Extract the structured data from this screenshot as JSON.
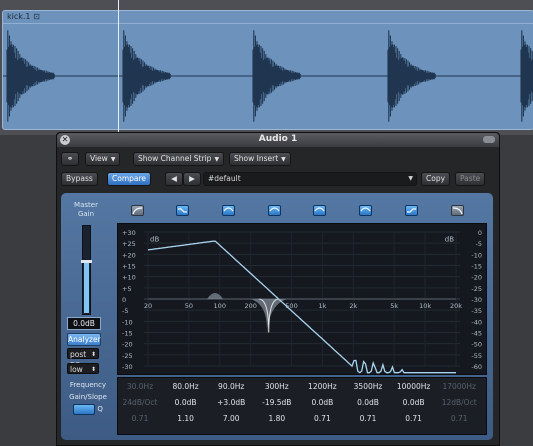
{
  "arrange": {
    "region_name": "kick.1 ⊡"
  },
  "window": {
    "title": "Audio 1",
    "toolbar": {
      "link_icon": "link-icon",
      "view": "View",
      "show_channel_strip": "Show Channel Strip",
      "show_insert": "Show Insert"
    },
    "controls": {
      "bypass": "Bypass",
      "compare": "Compare",
      "prev": "◀",
      "next": "▶",
      "preset": "#default",
      "copy": "Copy",
      "paste": "Paste"
    }
  },
  "eq": {
    "master_gain_label": "Master Gain",
    "master_gain_value": "0.0dB",
    "analyzer": "Analyzer",
    "analyzer_position": "post EQ",
    "resolution": "low",
    "db_unit_left": "dB",
    "db_unit_right": "dB",
    "gain_scale": [
      "+30",
      "+25",
      "+20",
      "+15",
      "+10",
      "+5",
      "0",
      "-5",
      "-10",
      "-15",
      "-20",
      "-25",
      "-30"
    ],
    "analyzer_scale": [
      "0",
      "-5",
      "-10",
      "-15",
      "-20",
      "-25",
      "-30",
      "-35",
      "-40",
      "-45",
      "-50",
      "-55",
      "-60"
    ],
    "freq_axis": [
      "20",
      "50",
      "100",
      "200",
      "500",
      "1k",
      "2k",
      "5k",
      "10k",
      "20k"
    ],
    "param_labels": {
      "frequency": "Frequency",
      "gain_slope": "Gain/Slope",
      "q": "Q"
    },
    "bands": [
      {
        "on": false,
        "frequency": "30.0Hz",
        "gain": "24dB/Oct",
        "q": "0.71",
        "icon": "low-cut-icon"
      },
      {
        "on": true,
        "frequency": "80.0Hz",
        "gain": "0.0dB",
        "q": "1.10",
        "icon": "low-shelf-icon"
      },
      {
        "on": true,
        "frequency": "90.0Hz",
        "gain": "+3.0dB",
        "q": "7.00",
        "icon": "bell-icon"
      },
      {
        "on": true,
        "frequency": "300Hz",
        "gain": "-19.5dB",
        "q": "1.80",
        "icon": "bell-icon"
      },
      {
        "on": true,
        "frequency": "1200Hz",
        "gain": "0.0dB",
        "q": "0.71",
        "icon": "bell-icon"
      },
      {
        "on": true,
        "frequency": "3500Hz",
        "gain": "0.0dB",
        "q": "0.71",
        "icon": "bell-icon"
      },
      {
        "on": true,
        "frequency": "10000Hz",
        "gain": "0.0dB",
        "q": "0.71",
        "icon": "high-shelf-icon"
      },
      {
        "on": false,
        "frequency": "17000Hz",
        "gain": "12dB/Oct",
        "q": "0.71",
        "icon": "high-cut-icon"
      }
    ]
  },
  "colors": {
    "panel": "#4a6c97",
    "graph_bg": "#15191f",
    "curve": "#a9d4f0",
    "accent": "#3b86d9",
    "waveform": "#1f3550"
  }
}
